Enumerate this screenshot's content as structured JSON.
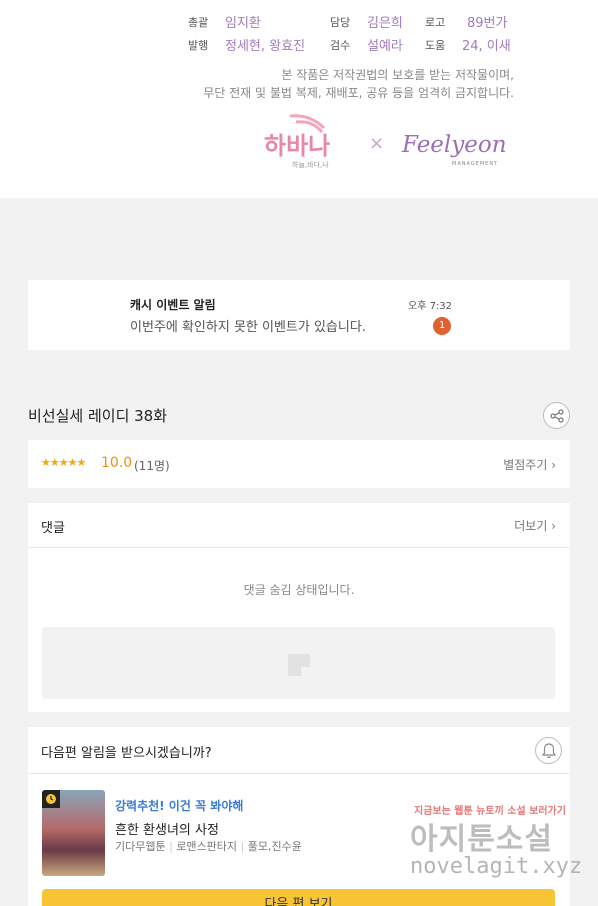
{
  "credits": {
    "rows": [
      {
        "l1": "총괄",
        "v1": "임지환",
        "l2": "담당",
        "v2": "김은희",
        "l3": "로고",
        "v3": "89번가"
      },
      {
        "l1": "발행",
        "v1": "정세현, 왕효진",
        "l2": "검수",
        "v2": "설예라",
        "l3": "도움",
        "v3": "24, 이새"
      }
    ],
    "notice_line1": "본 작품은 저작권법의 보호를 받는 저작물이며,",
    "notice_line2": "무단 전재 및 불법 복제, 재배포, 공유 등을 엄격히 금지합니다.",
    "logo_habana": "하바나",
    "logo_habana_sub": "하늘,바다,나",
    "logo_x": "×",
    "logo_feelyeon": "Feelyeon",
    "logo_feelyeon_sub": "MANAGEMENT"
  },
  "alert": {
    "title": "캐시 이벤트 알림",
    "body": "이번주에 확인하지 못한 이벤트가 있습니다.",
    "time": "오후 7:32",
    "count": "1"
  },
  "episode": {
    "title": "비선실세 레이디 38화"
  },
  "rating": {
    "stars": "★★★★★",
    "score": "10.0",
    "count": "(11명)",
    "rate_link": "별점주기 ›"
  },
  "comments": {
    "title": "댓글",
    "more_link": "더보기 ›",
    "hidden_message": "댓글 숨김 상태입니다."
  },
  "notify": {
    "question": "다음편 알림을 받으시겠습니까?"
  },
  "recommendation": {
    "tag": "강력추천! 이건 꼭 봐야해",
    "title": "흔한 환생녀의 사정",
    "meta": [
      "기다무웹툰",
      "로맨스판타지",
      "풀모,진수윤"
    ]
  },
  "cta": {
    "label": "다음 편 보기"
  },
  "watermark": {
    "top": "지금보는 웹툰 뉴토끼 소설 보러가기",
    "mid": "아지툰소설",
    "bottom": "novelagit.xyz"
  },
  "colors": {
    "credit_value": "#a27bbf",
    "star": "#f3a713",
    "alert_badge": "#e06030",
    "rec_tag": "#3a7bd5",
    "cta": "#f7c436"
  },
  "icons": [
    "share-icon",
    "bell-icon",
    "image-placeholder-icon",
    "clock-badge-icon"
  ]
}
